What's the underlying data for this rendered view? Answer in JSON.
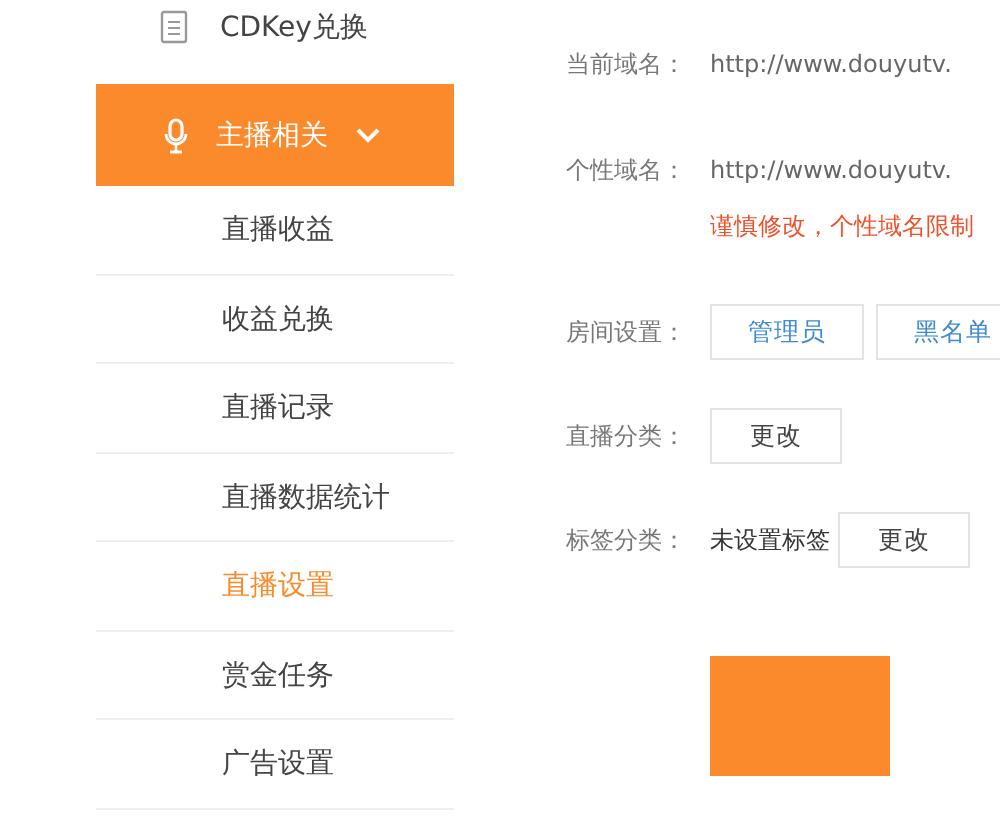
{
  "sidebar": {
    "top_item": {
      "label": "CDKey兑换"
    },
    "section": {
      "label": "主播相关",
      "expanded": true
    },
    "items": [
      {
        "label": "直播收益",
        "selected": false
      },
      {
        "label": "收益兑换",
        "selected": false
      },
      {
        "label": "直播记录",
        "selected": false
      },
      {
        "label": "直播数据统计",
        "selected": false
      },
      {
        "label": "直播设置",
        "selected": true
      },
      {
        "label": "赏金任务",
        "selected": false
      },
      {
        "label": "广告设置",
        "selected": false
      }
    ]
  },
  "settings": [
    {
      "kind": "text",
      "label": "当前域名：",
      "value": "http://www.douyutv."
    },
    {
      "kind": "text",
      "label": "个性域名：",
      "value": "http://www.douyutv.",
      "warning": "谨慎修改，个性域名限制"
    },
    {
      "kind": "buttons",
      "label": "房间设置：",
      "buttons": [
        "管理员",
        "黑名单"
      ]
    },
    {
      "kind": "buttons",
      "label": "直播分类：",
      "buttons": [
        "更改"
      ]
    },
    {
      "kind": "buttons",
      "label": "标签分类：",
      "value": "未设置标签",
      "buttons": [
        "更改"
      ]
    }
  ],
  "submit": {
    "kind": "primary"
  }
}
